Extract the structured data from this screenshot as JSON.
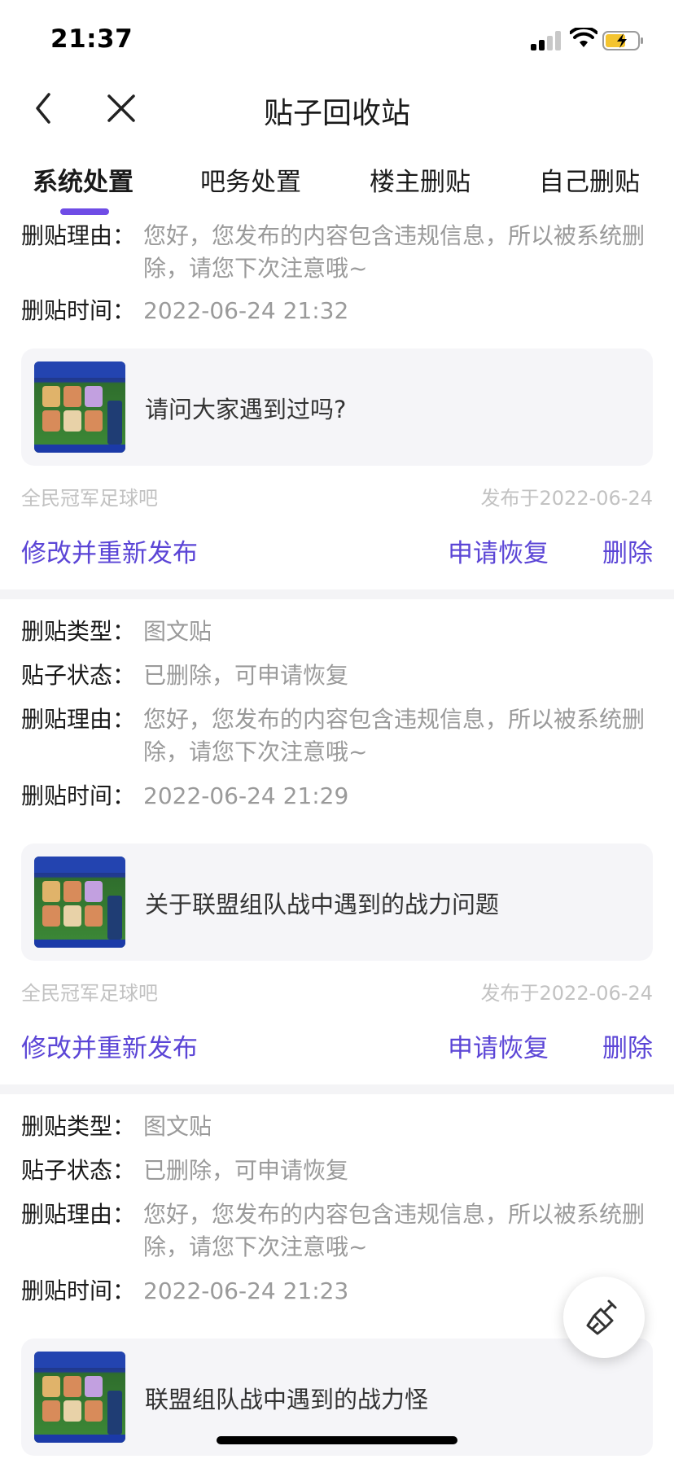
{
  "status_bar": {
    "time": "21:37"
  },
  "nav": {
    "title": "贴子回收站",
    "back_icon": "chevron-left-icon",
    "close_icon": "close-icon"
  },
  "tabs": [
    {
      "label": "系统处置",
      "active": true
    },
    {
      "label": "吧务处置",
      "active": false
    },
    {
      "label": "楼主删贴",
      "active": false
    },
    {
      "label": "自己删贴",
      "active": false
    }
  ],
  "labels": {
    "type": "删贴类型：",
    "status": "贴子状态：",
    "reason": "删贴理由：",
    "time": "删贴时间："
  },
  "posts": [
    {
      "reason": "您好，您发布的内容包含违规信息，所以被系统删除，请您下次注意哦~",
      "time": "2022-06-24 21:32",
      "title": "请问大家遇到过吗?",
      "forum": "全民冠军足球吧",
      "published": "发布于2022-06-24",
      "edit_label": "修改并重新发布",
      "restore_label": "申请恢复",
      "delete_label": "删除"
    },
    {
      "type": "图文贴",
      "status": "已删除，可申请恢复",
      "reason": "您好，您发布的内容包含违规信息，所以被系统删除，请您下次注意哦~",
      "time": "2022-06-24 21:29",
      "title": "关于联盟组队战中遇到的战力问题",
      "forum": "全民冠军足球吧",
      "published": "发布于2022-06-24",
      "edit_label": "修改并重新发布",
      "restore_label": "申请恢复",
      "delete_label": "删除"
    },
    {
      "type": "图文贴",
      "status": "已删除，可申请恢复",
      "reason": "您好，您发布的内容包含违规信息，所以被系统删除，请您下次注意哦~",
      "time": "2022-06-24 21:23",
      "title": "联盟组队战中遇到的战力怪"
    }
  ],
  "fab": {
    "icon": "broom-icon"
  },
  "colors": {
    "accent": "#6f4ce6",
    "action": "#5b45d6",
    "muted": "#9a9a9a"
  }
}
